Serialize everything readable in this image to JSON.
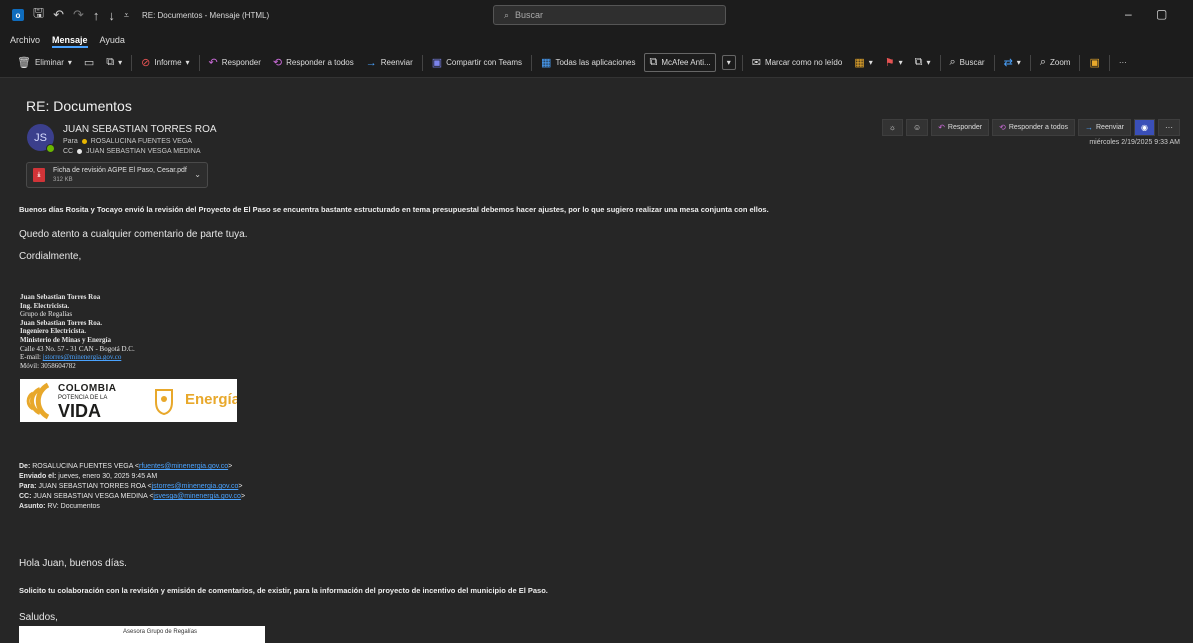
{
  "titlebar": {
    "title": "RE: Documentos - Mensaje (HTML)",
    "search_placeholder": "Buscar",
    "minimize": "–",
    "restore": "▢"
  },
  "menu": [
    "Archivo",
    "Mensaje",
    "Ayuda"
  ],
  "ribbon": {
    "eliminar": "Eliminar",
    "informe": "Informe",
    "responder": "Responder",
    "responder_todos": "Responder a todos",
    "reenviar": "Reenviar",
    "compartir_teams": "Compartir con Teams",
    "todas_apps": "Todas las aplicaciones",
    "mcafee": "McAfee Anti...",
    "marcar_no_leido": "Marcar como no leído",
    "buscar": "Buscar",
    "zoom": "Zoom",
    "more": "···"
  },
  "email": {
    "subject": "RE: Documentos",
    "avatar_initials": "JS",
    "sender": "JUAN SEBASTIAN TORRES ROA",
    "to_label": "Para",
    "to": "ROSALUCINA FUENTES VEGA",
    "cc_label": "CC",
    "cc": "JUAN SEBASTIAN VESGA MEDINA",
    "attachment": {
      "name": "Ficha de revisión AGPE El Paso, Cesar.pdf",
      "size": "312 KB"
    },
    "actions": {
      "responder": "Responder",
      "responder_todos": "Responder a todos",
      "reenviar": "Reenviar"
    },
    "date": "miércoles 2/19/2025 9:33 AM",
    "body_line1": "Buenos días Rosita y Tocayo envió la revisión del Proyecto de El Paso se encuentra bastante estructurado en tema presupuestal debemos hacer ajustes, por lo que sugiero realizar una mesa conjunta con ellos.",
    "body_line2": "Quedo atento a cualquier comentario de parte tuya.",
    "body_line3": "Cordialmente,"
  },
  "signature": {
    "name": "Juan Sebastian Torres Roa",
    "title": "Ing. Electricista.",
    "group": "Grupo de Regalías",
    "name2": "Juan Sebastian Torres Roa.",
    "title2": "Ingeniero Electricista.",
    "ministry": "Ministerio de Minas y Energía",
    "address": "Calle 43 No. 57 - 31 CAN - Bogotá D.C.",
    "email_label": "E-mail:",
    "email": "jstorres@minenergia.gov.co",
    "mobile": "Móvil: 3058604782"
  },
  "logo": {
    "colombia": "COLOMBIA",
    "potencia": "POTENCIA DE LA",
    "vida": "VIDA",
    "energia": "Energía"
  },
  "quoted": {
    "de_label": "De:",
    "de": "ROSALUCINA FUENTES VEGA <",
    "de_email": "rfuentes@minenergia.gov.co",
    "enviado_label": "Enviado el:",
    "enviado": "jueves, enero 30, 2025 9:45 AM",
    "para_label": "Para:",
    "para": "JUAN SEBASTIAN TORRES ROA <",
    "para_email": "jstorres@minenergia.gov.co",
    "cc_label": "CC:",
    "cc": "JUAN SEBASTIAN VESGA MEDINA <",
    "cc_email": "jsvesga@minenergia.gov.co",
    "asunto_label": "Asunto:",
    "asunto": "RV: Documentos",
    "close": ">"
  },
  "reply": {
    "greeting": "Hola Juan, buenos días.",
    "request": "Solicito tu colaboración con la revisión y emisión de comentarios, de existir, para la información del proyecto de incentivo del municipio de El Paso.",
    "saludos": "Saludos,",
    "thumb_text": "Asesora Grupo de Regalías"
  }
}
